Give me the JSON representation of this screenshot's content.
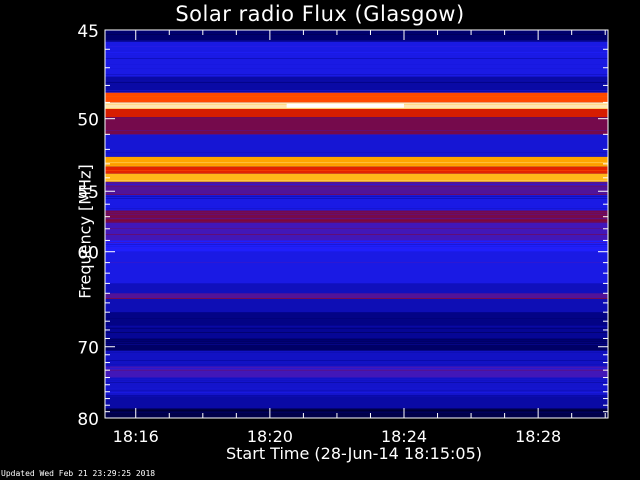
{
  "footer_text": "Updated Wed Feb 21 23:29:25 2018",
  "chart_data": {
    "type": "heatmap",
    "title": "Solar radio Flux (Glasgow)",
    "ylabel": "Frequency [MHz]",
    "xlabel": "Start Time (28-Jun-14 18:15:05)",
    "y_scale": "reciprocal",
    "ylim": [
      45,
      80
    ],
    "yticks": [
      45,
      50,
      55,
      60,
      70,
      80
    ],
    "xlim": [
      "18:15:05",
      "18:30:05"
    ],
    "xticks": [
      "18:16",
      "18:20",
      "18:24",
      "18:28"
    ],
    "colormap": [
      "#000000",
      "#00007a",
      "#2020ff",
      "#9a0000",
      "#ff3000",
      "#ffb000",
      "#ffffff"
    ],
    "bands": [
      {
        "from_mhz": 45.0,
        "to_mhz": 45.6,
        "level": 0.15
      },
      {
        "from_mhz": 45.6,
        "to_mhz": 47.5,
        "level": 0.3
      },
      {
        "from_mhz": 47.5,
        "to_mhz": 48.4,
        "level": 0.22
      },
      {
        "from_mhz": 48.4,
        "to_mhz": 49.0,
        "level": 0.7
      },
      {
        "from_mhz": 49.0,
        "to_mhz": 49.4,
        "level": 0.95
      },
      {
        "from_mhz": 49.4,
        "to_mhz": 49.9,
        "level": 0.6
      },
      {
        "from_mhz": 49.9,
        "to_mhz": 51.0,
        "level": 0.45
      },
      {
        "from_mhz": 51.0,
        "to_mhz": 52.5,
        "level": 0.28
      },
      {
        "from_mhz": 52.5,
        "to_mhz": 53.2,
        "level": 0.82
      },
      {
        "from_mhz": 53.2,
        "to_mhz": 53.7,
        "level": 0.62
      },
      {
        "from_mhz": 53.7,
        "to_mhz": 54.3,
        "level": 0.85
      },
      {
        "from_mhz": 54.3,
        "to_mhz": 55.3,
        "level": 0.4
      },
      {
        "from_mhz": 55.3,
        "to_mhz": 56.5,
        "level": 0.3
      },
      {
        "from_mhz": 56.5,
        "to_mhz": 57.5,
        "level": 0.45
      },
      {
        "from_mhz": 57.5,
        "to_mhz": 59.0,
        "level": 0.38
      },
      {
        "from_mhz": 59.0,
        "to_mhz": 60.0,
        "level": 0.33
      },
      {
        "from_mhz": 60.0,
        "to_mhz": 63.0,
        "level": 0.3
      },
      {
        "from_mhz": 63.0,
        "to_mhz": 64.0,
        "level": 0.25
      },
      {
        "from_mhz": 64.0,
        "to_mhz": 64.6,
        "level": 0.4
      },
      {
        "from_mhz": 64.6,
        "to_mhz": 66.0,
        "level": 0.24
      },
      {
        "from_mhz": 66.0,
        "to_mhz": 67.5,
        "level": 0.18
      },
      {
        "from_mhz": 67.5,
        "to_mhz": 69.0,
        "level": 0.2
      },
      {
        "from_mhz": 69.0,
        "to_mhz": 70.5,
        "level": 0.14
      },
      {
        "from_mhz": 70.5,
        "to_mhz": 72.5,
        "level": 0.26
      },
      {
        "from_mhz": 72.5,
        "to_mhz": 74.0,
        "level": 0.38
      },
      {
        "from_mhz": 74.0,
        "to_mhz": 76.5,
        "level": 0.27
      },
      {
        "from_mhz": 76.5,
        "to_mhz": 78.5,
        "level": 0.22
      },
      {
        "from_mhz": 78.5,
        "to_mhz": 80.0,
        "level": 0.1
      }
    ],
    "hot_streak": {
      "from_time": "18:20:30",
      "to_time": "18:24:00",
      "mhz": 49.2,
      "level": 1.0
    }
  }
}
